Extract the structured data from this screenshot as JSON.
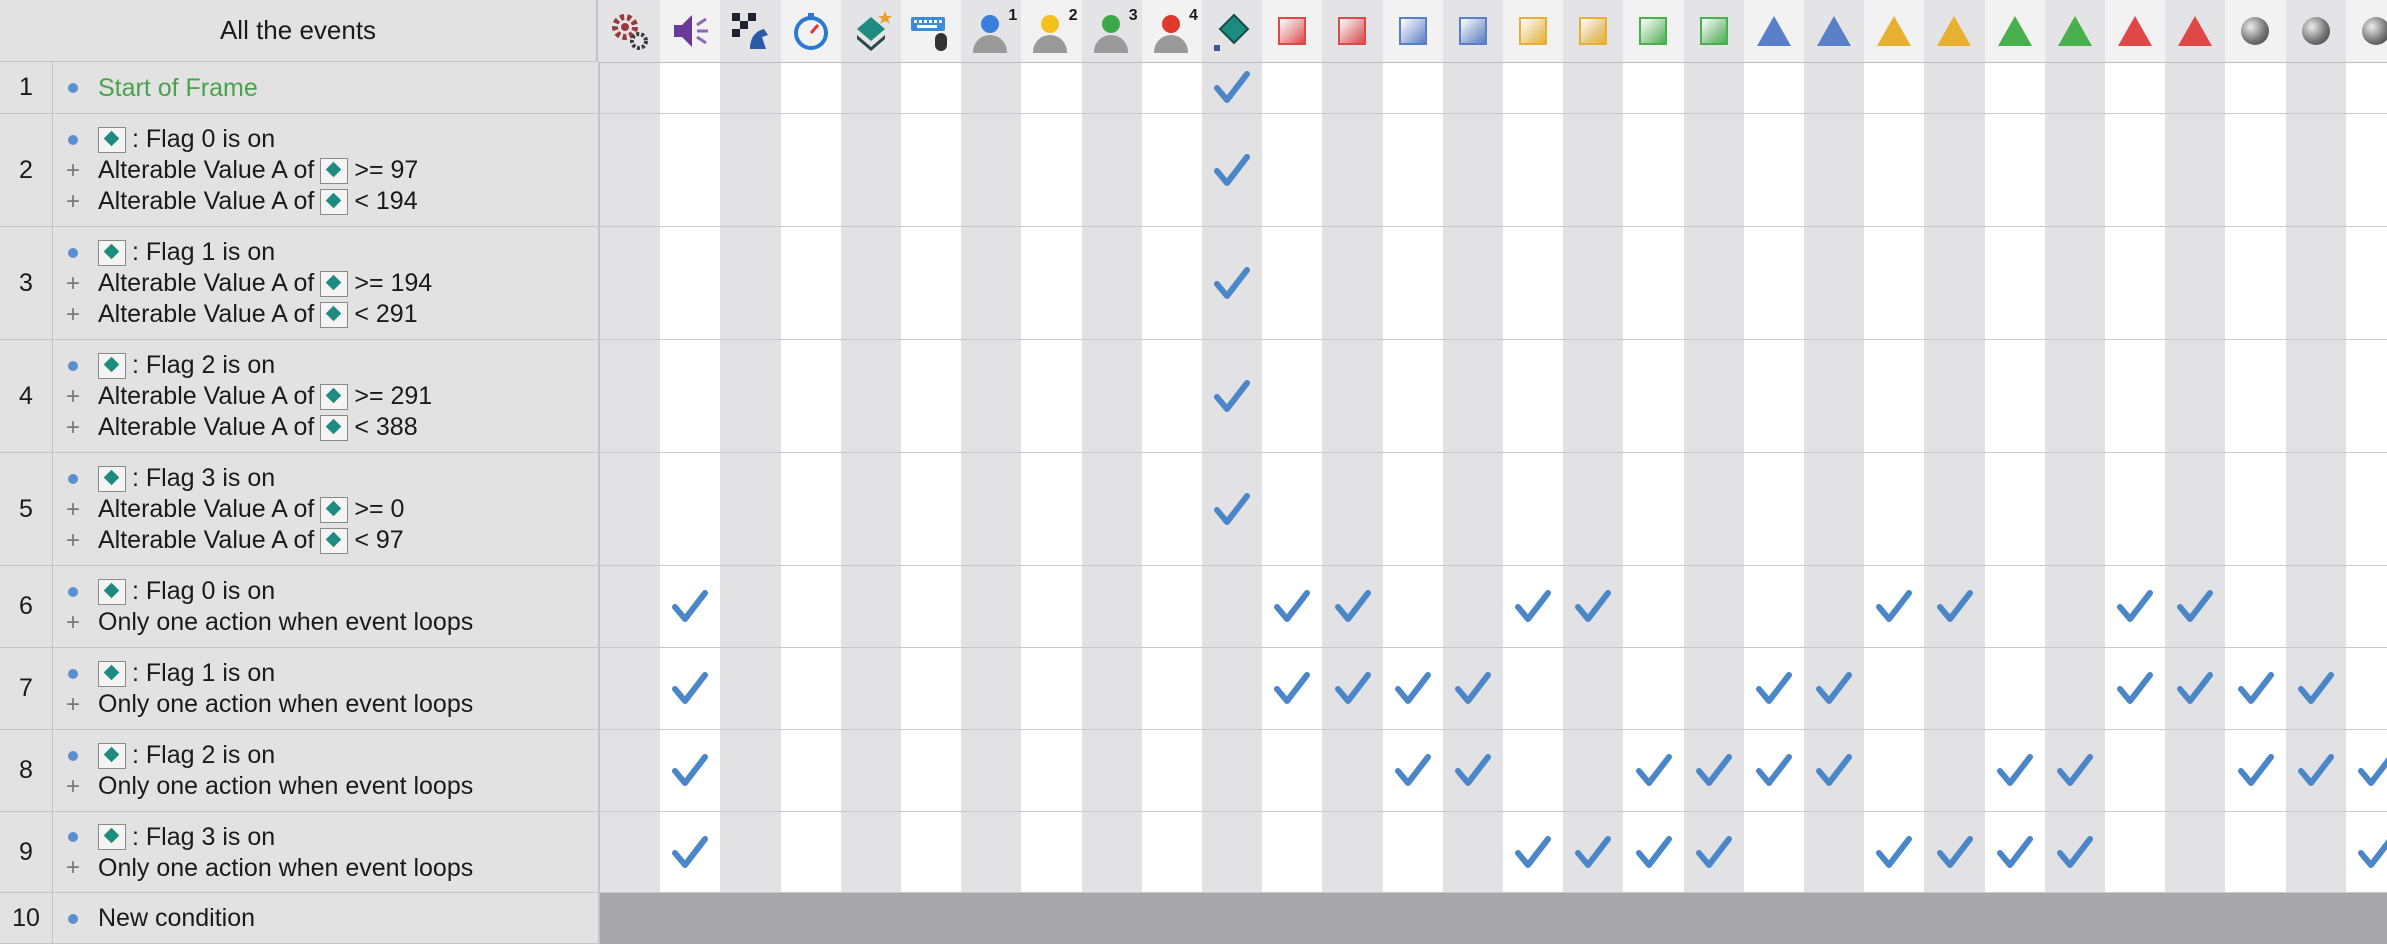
{
  "header": {
    "title": "All the events"
  },
  "columns": [
    {
      "name": "special-icon",
      "kind": "special"
    },
    {
      "name": "sound-icon",
      "kind": "sound"
    },
    {
      "name": "storyboard-icon",
      "kind": "storyboard"
    },
    {
      "name": "timer-icon",
      "kind": "timer"
    },
    {
      "name": "create-objects-icon",
      "kind": "create"
    },
    {
      "name": "keyboard-mouse-icon",
      "kind": "keyboard"
    },
    {
      "name": "player-1-icon",
      "kind": "player",
      "label": "1",
      "color": "#3a7fe0"
    },
    {
      "name": "player-2-icon",
      "kind": "player",
      "label": "2",
      "color": "#f2c21a"
    },
    {
      "name": "player-3-icon",
      "kind": "player",
      "label": "3",
      "color": "#3aaa4a"
    },
    {
      "name": "player-4-icon",
      "kind": "player",
      "label": "4",
      "color": "#e0392e"
    },
    {
      "name": "active-object-icon",
      "kind": "diamond"
    },
    {
      "name": "red-square-icon",
      "kind": "square",
      "color": "#e04848"
    },
    {
      "name": "red-square-icon-2",
      "kind": "square",
      "color": "#e04848"
    },
    {
      "name": "blue-square-icon",
      "kind": "square",
      "color": "#5a7fc8"
    },
    {
      "name": "blue-square-icon-2",
      "kind": "square",
      "color": "#5a7fc8"
    },
    {
      "name": "yellow-square-icon",
      "kind": "square",
      "color": "#e8b030"
    },
    {
      "name": "yellow-square-icon-2",
      "kind": "square",
      "color": "#e8b030"
    },
    {
      "name": "green-square-icon",
      "kind": "square",
      "color": "#4ab04e"
    },
    {
      "name": "green-square-icon-2",
      "kind": "square",
      "color": "#4ab04e"
    },
    {
      "name": "blue-triangle-icon",
      "kind": "triangle",
      "color": "#5a7fc8"
    },
    {
      "name": "blue-triangle-icon-2",
      "kind": "triangle",
      "color": "#5a7fc8"
    },
    {
      "name": "yellow-triangle-icon",
      "kind": "triangle",
      "color": "#e8b030"
    },
    {
      "name": "yellow-triangle-icon-2",
      "kind": "triangle",
      "color": "#e8b030"
    },
    {
      "name": "green-triangle-icon",
      "kind": "triangle",
      "color": "#4ab04e"
    },
    {
      "name": "green-triangle-icon-2",
      "kind": "triangle",
      "color": "#4ab04e"
    },
    {
      "name": "red-triangle-icon",
      "kind": "triangle",
      "color": "#e04848"
    },
    {
      "name": "red-triangle-icon-2",
      "kind": "triangle",
      "color": "#e04848"
    },
    {
      "name": "gray-ball-icon",
      "kind": "ball"
    },
    {
      "name": "gray-ball-icon-2",
      "kind": "ball"
    },
    {
      "name": "gray-ball-icon-3",
      "kind": "ball"
    }
  ],
  "events": [
    {
      "num": "1",
      "lines": [
        {
          "type": "bullet",
          "text": "Start of Frame",
          "green": true
        }
      ],
      "checks": [
        10
      ]
    },
    {
      "num": "2",
      "lines": [
        {
          "type": "bullet",
          "obj": true,
          "text": ": Flag 0 is on"
        },
        {
          "type": "plus",
          "pre": "Alterable Value A of",
          "obj": true,
          "text": ">= 97"
        },
        {
          "type": "plus",
          "pre": "Alterable Value A of",
          "obj": true,
          "text": "< 194"
        }
      ],
      "checks": [
        10
      ]
    },
    {
      "num": "3",
      "lines": [
        {
          "type": "bullet",
          "obj": true,
          "text": ": Flag 1 is on"
        },
        {
          "type": "plus",
          "pre": "Alterable Value A of",
          "obj": true,
          "text": ">= 194"
        },
        {
          "type": "plus",
          "pre": "Alterable Value A of",
          "obj": true,
          "text": "< 291"
        }
      ],
      "checks": [
        10
      ]
    },
    {
      "num": "4",
      "lines": [
        {
          "type": "bullet",
          "obj": true,
          "text": ": Flag 2 is on"
        },
        {
          "type": "plus",
          "pre": "Alterable Value A of",
          "obj": true,
          "text": ">= 291"
        },
        {
          "type": "plus",
          "pre": "Alterable Value A of",
          "obj": true,
          "text": "< 388"
        }
      ],
      "checks": [
        10
      ]
    },
    {
      "num": "5",
      "lines": [
        {
          "type": "bullet",
          "obj": true,
          "text": ": Flag 3 is on"
        },
        {
          "type": "plus",
          "pre": "Alterable Value A of",
          "obj": true,
          "text": ">= 0"
        },
        {
          "type": "plus",
          "pre": "Alterable Value A of",
          "obj": true,
          "text": "< 97"
        }
      ],
      "checks": [
        10
      ]
    },
    {
      "num": "6",
      "lines": [
        {
          "type": "bullet",
          "obj": true,
          "text": ": Flag 0 is on"
        },
        {
          "type": "plus",
          "text": "Only one action when event loops"
        }
      ],
      "checks": [
        1,
        11,
        12,
        15,
        16,
        21,
        22,
        25,
        26
      ]
    },
    {
      "num": "7",
      "lines": [
        {
          "type": "bullet",
          "obj": true,
          "text": ": Flag 1 is on"
        },
        {
          "type": "plus",
          "text": "Only one action when event loops"
        }
      ],
      "checks": [
        1,
        11,
        12,
        13,
        14,
        19,
        20,
        25,
        26,
        27,
        28
      ]
    },
    {
      "num": "8",
      "lines": [
        {
          "type": "bullet",
          "obj": true,
          "text": ": Flag 2 is on"
        },
        {
          "type": "plus",
          "text": "Only one action when event loops"
        }
      ],
      "checks": [
        1,
        13,
        14,
        17,
        18,
        19,
        20,
        23,
        24,
        27,
        28,
        29
      ]
    },
    {
      "num": "9",
      "lines": [
        {
          "type": "bullet",
          "obj": true,
          "text": ": Flag 3 is on"
        },
        {
          "type": "plus",
          "text": "Only one action when event loops"
        }
      ],
      "checks": [
        1,
        15,
        16,
        17,
        18,
        21,
        22,
        23,
        24,
        29
      ]
    },
    {
      "num": "10",
      "lines": [
        {
          "type": "bullet",
          "text": "New condition"
        }
      ],
      "checks": []
    }
  ],
  "colors": {
    "check": "#4a86c8",
    "shade": "#e2e2e4",
    "panel": "#e2e2e2",
    "bottom": "#a7a7a9"
  }
}
